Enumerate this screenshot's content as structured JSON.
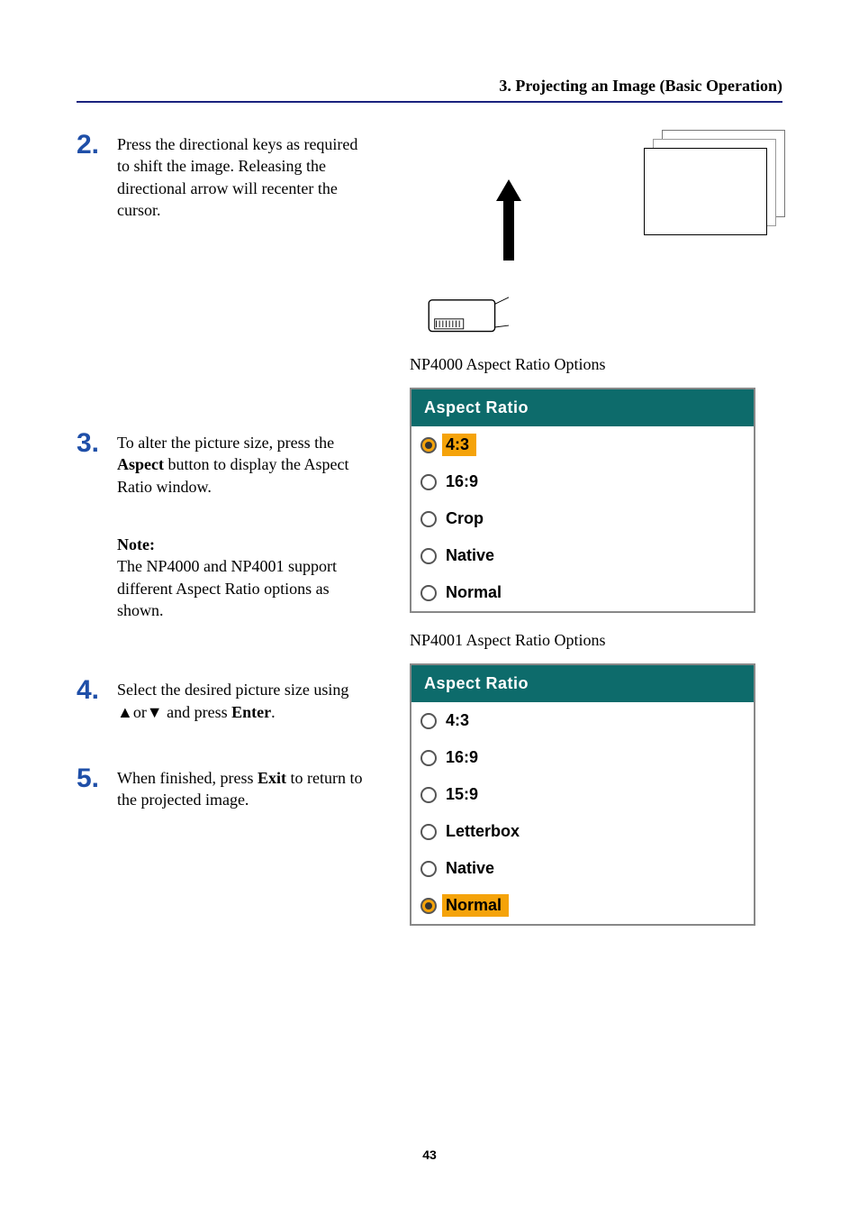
{
  "header": "3. Projecting an Image (Basic Operation)",
  "page_number": "43",
  "steps": {
    "s2": {
      "num": "2.",
      "text_before": "Press the directional keys as required to shift the image. Releasing the directional arrow will recenter the cursor."
    },
    "s3": {
      "num": "3.",
      "text_a": "To alter the picture size, press the ",
      "bold_a": "Aspect",
      "text_b": " button to display the Aspect Ratio window."
    },
    "note": {
      "title": "Note:",
      "body": "The NP4000 and NP4001 support different Aspect Ratio options as shown."
    },
    "s4": {
      "num": "4.",
      "text_a": "Select the desired picture size using ▲or▼ and press ",
      "bold_a": "Enter",
      "text_b": "."
    },
    "s5": {
      "num": "5.",
      "text_a": "When finished, press ",
      "bold_a": "Exit",
      "text_b": " to return to the projected image."
    }
  },
  "right": {
    "caption1": "NP4000 Aspect Ratio Options",
    "caption2": "NP4001 Aspect Ratio Options",
    "menu1_title": "Aspect Ratio",
    "menu2_title": "Aspect Ratio",
    "menu1": [
      {
        "label": "4:3",
        "selected": true
      },
      {
        "label": "16:9",
        "selected": false
      },
      {
        "label": "Crop",
        "selected": false
      },
      {
        "label": "Native",
        "selected": false
      },
      {
        "label": "Normal",
        "selected": false
      }
    ],
    "menu2": [
      {
        "label": "4:3",
        "selected": false
      },
      {
        "label": "16:9",
        "selected": false
      },
      {
        "label": "15:9",
        "selected": false
      },
      {
        "label": "Letterbox",
        "selected": false
      },
      {
        "label": "Native",
        "selected": false
      },
      {
        "label": "Normal",
        "selected": true
      }
    ]
  }
}
